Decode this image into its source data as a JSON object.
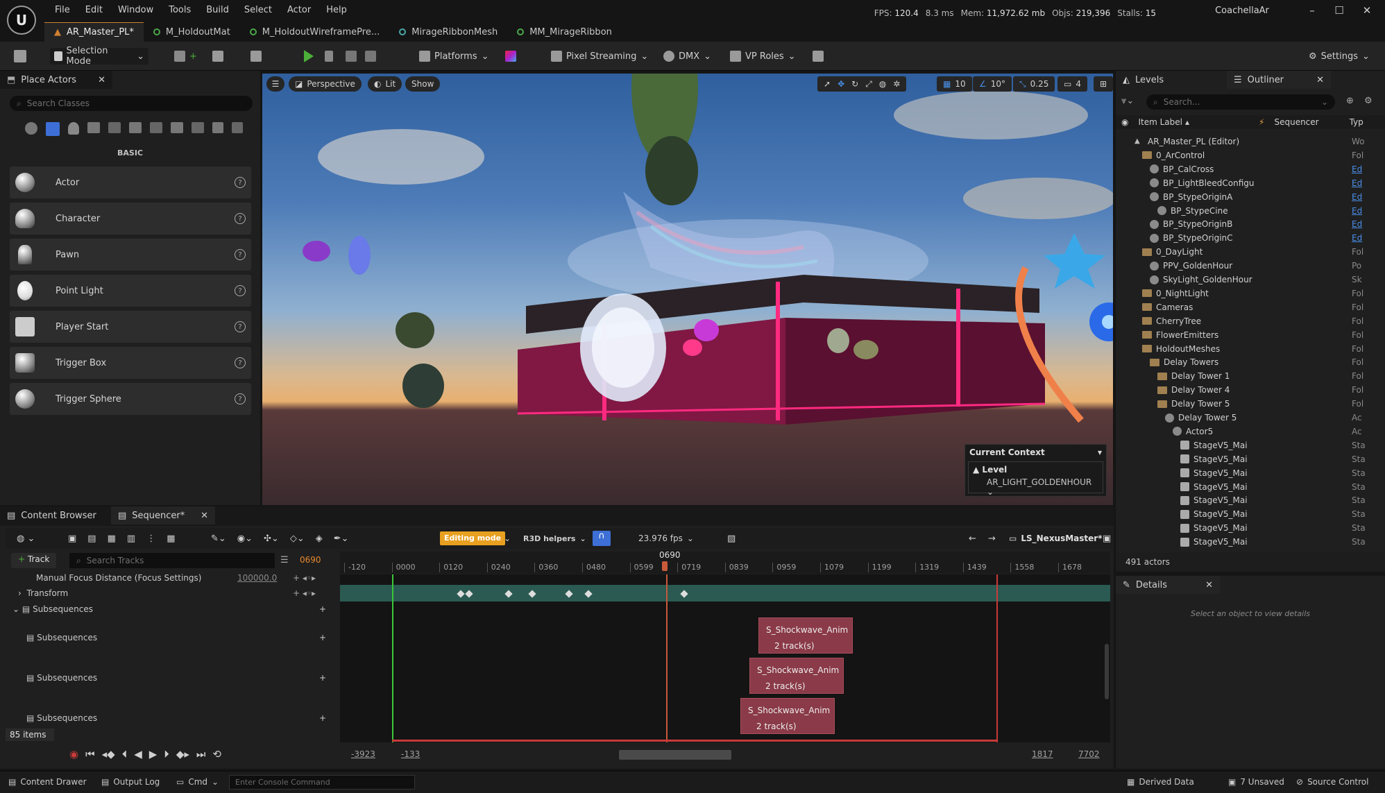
{
  "app": {
    "menu": [
      "File",
      "Edit",
      "Window",
      "Tools",
      "Build",
      "Select",
      "Actor",
      "Help"
    ],
    "stats": {
      "fps_label": "FPS:",
      "fps": "120.4",
      "ms": "8.3 ms",
      "mem_label": "Mem:",
      "mem": "11,972.62 mb",
      "objs_label": "Objs:",
      "objs": "219,396",
      "stalls_label": "Stalls:",
      "stalls": "15"
    },
    "project": "CoachellaAr",
    "doc_tabs": [
      "AR_Master_PL*",
      "M_HoldoutMat",
      "M_HoldoutWireframePre...",
      "MirageRibbonMesh",
      "MM_MirageRibbon"
    ]
  },
  "toolbar": {
    "selection_mode": "Selection Mode",
    "platforms": "Platforms",
    "pixel_streaming": "Pixel Streaming",
    "dmx": "DMX",
    "vp_roles": "VP Roles",
    "settings": "Settings"
  },
  "place_actors": {
    "tab": "Place Actors",
    "search_placeholder": "Search Classes",
    "category": "BASIC",
    "items": [
      "Actor",
      "Character",
      "Pawn",
      "Point Light",
      "Player Start",
      "Trigger Box",
      "Trigger Sphere"
    ]
  },
  "viewport": {
    "perspective": "Perspective",
    "lit": "Lit",
    "show": "Show",
    "grid": "10",
    "angle": "10°",
    "scale": "0.25",
    "cam": "4",
    "context_title": "Current Context",
    "context_level_label": "Level",
    "context_level_value": "AR_LIGHT_GOLDENHOUR"
  },
  "outliner": {
    "levels_tab": "Levels",
    "outliner_tab": "Outliner",
    "search_placeholder": "Search...",
    "col_label": "Item Label",
    "col_seq": "Sequencer",
    "col_type": "Typ",
    "rows": [
      {
        "label": "AR_Master_PL (Editor)",
        "type": "Wo",
        "depth": 1,
        "kind": "world",
        "link": false
      },
      {
        "label": "0_ArControl",
        "type": "Fol",
        "depth": 2,
        "kind": "folder",
        "link": false
      },
      {
        "label": "BP_CalCross",
        "type": "Ed",
        "depth": 3,
        "kind": "obj",
        "link": true
      },
      {
        "label": "BP_LightBleedConfigu",
        "type": "Ed",
        "depth": 3,
        "kind": "obj",
        "link": true
      },
      {
        "label": "BP_StypeOriginA",
        "type": "Ed",
        "depth": 3,
        "kind": "obj",
        "link": true
      },
      {
        "label": "BP_StypeCine",
        "type": "Ed",
        "depth": 4,
        "kind": "obj",
        "link": true
      },
      {
        "label": "BP_StypeOriginB",
        "type": "Ed",
        "depth": 3,
        "kind": "obj",
        "link": true
      },
      {
        "label": "BP_StypeOriginC",
        "type": "Ed",
        "depth": 3,
        "kind": "obj",
        "link": true
      },
      {
        "label": "0_DayLight",
        "type": "Fol",
        "depth": 2,
        "kind": "folder",
        "link": false
      },
      {
        "label": "PPV_GoldenHour",
        "type": "Po",
        "depth": 3,
        "kind": "obj",
        "link": false
      },
      {
        "label": "SkyLight_GoldenHour",
        "type": "Sk",
        "depth": 3,
        "kind": "obj",
        "link": false
      },
      {
        "label": "0_NightLight",
        "type": "Fol",
        "depth": 2,
        "kind": "folder",
        "link": false
      },
      {
        "label": "Cameras",
        "type": "Fol",
        "depth": 2,
        "kind": "folder",
        "link": false
      },
      {
        "label": "CherryTree",
        "type": "Fol",
        "depth": 2,
        "kind": "folder",
        "link": false
      },
      {
        "label": "FlowerEmitters",
        "type": "Fol",
        "depth": 2,
        "kind": "folder",
        "link": false
      },
      {
        "label": "HoldoutMeshes",
        "type": "Fol",
        "depth": 2,
        "kind": "folder",
        "link": false
      },
      {
        "label": "Delay Towers",
        "type": "Fol",
        "depth": 3,
        "kind": "folder",
        "link": false
      },
      {
        "label": "Delay Tower 1",
        "type": "Fol",
        "depth": 4,
        "kind": "folder",
        "link": false
      },
      {
        "label": "Delay Tower 4",
        "type": "Fol",
        "depth": 4,
        "kind": "folder",
        "link": false
      },
      {
        "label": "Delay Tower 5",
        "type": "Fol",
        "depth": 4,
        "kind": "folder",
        "link": false
      },
      {
        "label": "Delay Tower 5",
        "type": "Ac",
        "depth": 5,
        "kind": "obj",
        "link": false
      },
      {
        "label": "Actor5",
        "type": "Ac",
        "depth": 6,
        "kind": "obj",
        "link": false
      },
      {
        "label": "StageV5_Mai",
        "type": "Sta",
        "depth": 7,
        "kind": "mesh",
        "link": false
      },
      {
        "label": "StageV5_Mai",
        "type": "Sta",
        "depth": 7,
        "kind": "mesh",
        "link": false
      },
      {
        "label": "StageV5_Mai",
        "type": "Sta",
        "depth": 7,
        "kind": "mesh",
        "link": false
      },
      {
        "label": "StageV5_Mai",
        "type": "Sta",
        "depth": 7,
        "kind": "mesh",
        "link": false
      },
      {
        "label": "StageV5_Mai",
        "type": "Sta",
        "depth": 7,
        "kind": "mesh",
        "link": false
      },
      {
        "label": "StageV5_Mai",
        "type": "Sta",
        "depth": 7,
        "kind": "mesh",
        "link": false
      },
      {
        "label": "StageV5_Mai",
        "type": "Sta",
        "depth": 7,
        "kind": "mesh",
        "link": false
      },
      {
        "label": "StageV5_Mai",
        "type": "Sta",
        "depth": 7,
        "kind": "mesh",
        "link": false
      }
    ],
    "actor_count": "491 actors",
    "details_tab": "Details",
    "details_hint": "Select an object to view details"
  },
  "sequencer": {
    "content_browser_tab": "Content Browser",
    "sequencer_tab": "Sequencer*",
    "editing_mode": "Editing mode",
    "r3d_helpers": "R3D helpers",
    "fps": "23.976 fps",
    "sequence_name": "LS_NexusMaster*",
    "add_track": "Track",
    "search_tracks": "Search Tracks",
    "current_frame": "0690",
    "ruler": [
      "-120",
      "0000",
      "0120",
      "0240",
      "0360",
      "0480",
      "0599",
      "0719",
      "0839",
      "0959",
      "1079",
      "1199",
      "1319",
      "1439",
      "1558",
      "1678"
    ],
    "tracks": [
      {
        "label": "Manual Focus Distance (Focus Settings)",
        "value": "100000.0"
      },
      {
        "label": "Transform",
        "value": ""
      },
      {
        "label": "Subsequences",
        "value": ""
      },
      {
        "label": "Subsequences",
        "value": ""
      },
      {
        "label": "Subsequences",
        "value": ""
      },
      {
        "label": "Subsequences",
        "value": ""
      }
    ],
    "sections": [
      {
        "title": "S_Shockwave_Anim",
        "sub": "2 track(s)"
      },
      {
        "title": "S_Shockwave_Anim",
        "sub": "2 track(s)"
      },
      {
        "title": "S_Shockwave_Anim",
        "sub": "2 track(s)"
      }
    ],
    "item_count": "85 items",
    "range": {
      "start": "-3923",
      "in": "-133",
      "out": "1817",
      "end": "7702"
    }
  },
  "statusbar": {
    "content_drawer": "Content Drawer",
    "output_log": "Output Log",
    "cmd": "Cmd",
    "console_placeholder": "Enter Console Command",
    "derived_data": "Derived Data",
    "unsaved": "7 Unsaved",
    "source_control": "Source Control"
  }
}
